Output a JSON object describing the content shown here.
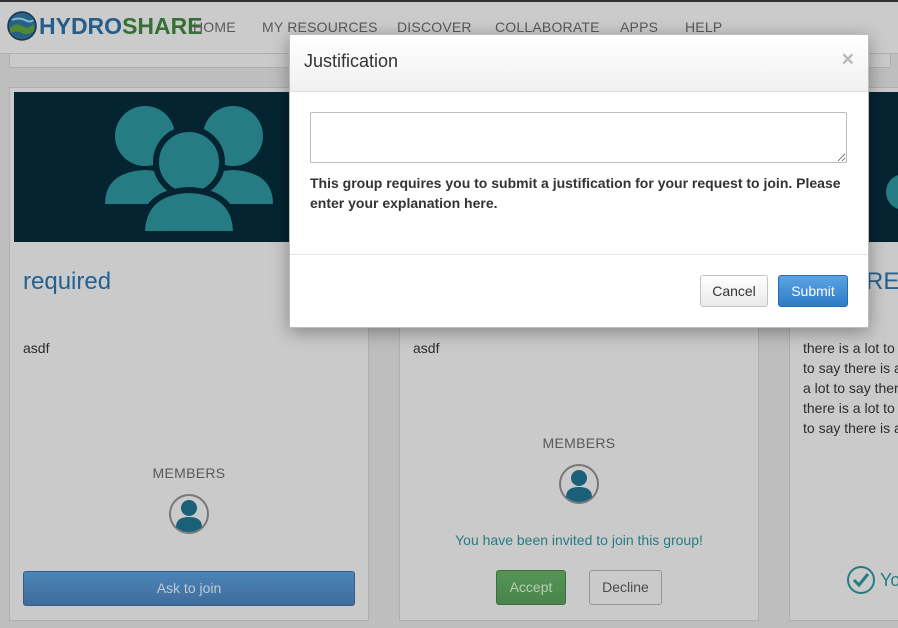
{
  "navbar": {
    "logo_hydro": "HYDRO",
    "logo_share": "SHARE",
    "items": [
      "HOME",
      "MY RESOURCES",
      "DISCOVER",
      "COLLABORATE",
      "APPS",
      "HELP"
    ]
  },
  "cards": [
    {
      "title": "required",
      "description": "asdf",
      "members_label": "MEMBERS",
      "join_button": "Ask to join"
    },
    {
      "description": "asdf",
      "members_label": "MEMBERS",
      "invite_message": "You have been invited to join this group!",
      "accept_button": "Accept",
      "decline_button": "Decline"
    },
    {
      "heading_fragment": "RE",
      "description_lines": [
        "there is a lot to",
        "to say there is a",
        "a lot to say ther",
        "there is a lot to",
        "to say there is a"
      ],
      "status_fragment": "Yo"
    }
  ],
  "modal": {
    "title": "Justification",
    "close_glyph": "×",
    "textarea_value": "",
    "help_text": "This group requires you to submit a justification for your request to join. Please enter your explanation here.",
    "cancel_label": "Cancel",
    "submit_label": "Submit"
  },
  "colors": {
    "banner": "#06293a",
    "group_icon": "#2b8e96",
    "link_blue": "#2a6fa5",
    "submit_blue": "#3d8bd0",
    "accept_green": "#4c9e4c"
  },
  "icons": {
    "banner": "group-icon",
    "member": "user-avatar-icon",
    "check": "check-circle-icon",
    "close": "close-icon"
  }
}
